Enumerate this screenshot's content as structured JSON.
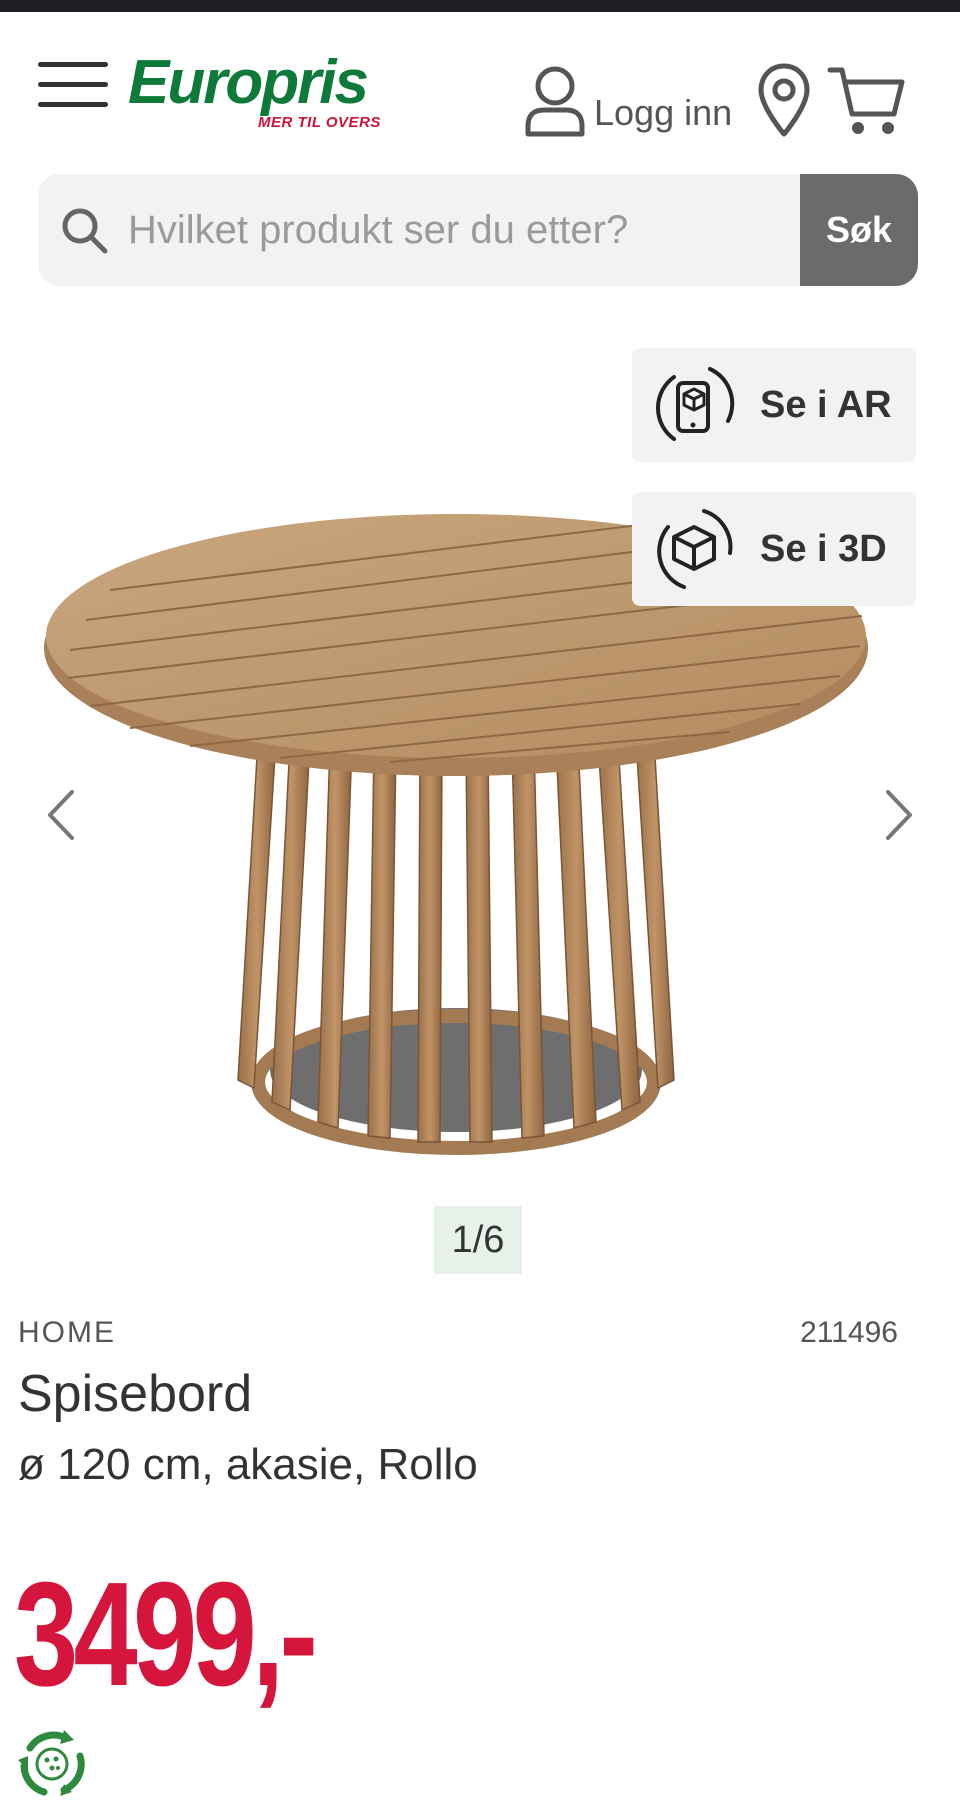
{
  "header": {
    "logo_text": "Europris",
    "logo_tagline": "MER TIL OVERS",
    "login_label": "Logg inn",
    "icons": [
      "menu-icon",
      "user-icon",
      "location-pin-icon",
      "cart-icon"
    ]
  },
  "search": {
    "placeholder": "Hvilket produkt ser du etter?",
    "value": "",
    "button_label": "Søk"
  },
  "gallery": {
    "view_ar_label": "Se i AR",
    "view_3d_label": "Se i 3D",
    "counter": "1/6"
  },
  "product": {
    "brand": "HOME",
    "sku": "211496",
    "title": "Spisebord",
    "subtitle": "ø 120 cm, akasie, Rollo",
    "price": "3499,-"
  },
  "colors": {
    "brand_green": "#0e7a3a",
    "price_red": "#d5153b",
    "search_button": "#6b6b6b"
  }
}
